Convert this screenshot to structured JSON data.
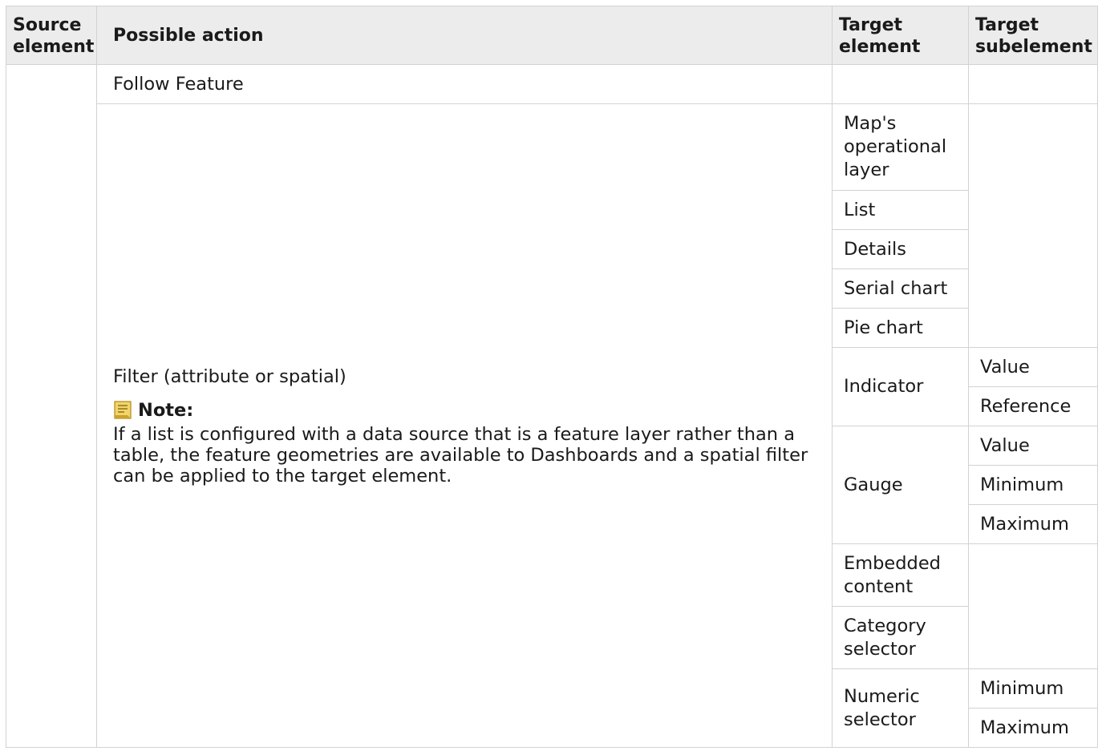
{
  "headers": {
    "source": "Source element",
    "action": "Possible action",
    "target": "Target element",
    "subelement": "Target subelement"
  },
  "rows": {
    "follow": {
      "action": "Follow Feature",
      "target": "",
      "subelement": ""
    },
    "filter": {
      "action": "Filter (attribute or spatial)",
      "note_title": "Note:",
      "note_text": "If a list is configured with a data source that is a feature layer rather than a table, the feature geometries are available to Dashboards and a spatial filter can be applied to the target element."
    }
  },
  "targets": {
    "map": "Map's operational layer",
    "list": "List",
    "details": "Details",
    "serial": "Serial chart",
    "pie": "Pie chart",
    "indicator": "Indicator",
    "gauge": "Gauge",
    "embedded": "Embedded content",
    "category": "Category selector",
    "numeric": "Numeric selector"
  },
  "subelements": {
    "indicator_value": "Value",
    "indicator_reference": "Reference",
    "gauge_value": "Value",
    "gauge_minimum": "Minimum",
    "gauge_maximum": "Maximum",
    "numeric_minimum": "Minimum",
    "numeric_maximum": "Maximum"
  },
  "icons": {
    "note": "note-icon"
  },
  "colors": {
    "header_bg": "#ececec",
    "border": "#d2d2d2",
    "note_icon": "#d9b23a"
  }
}
